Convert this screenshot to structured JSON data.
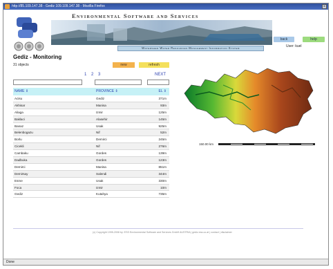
{
  "window": {
    "title": "http://85.109.147.38 - Gediz 109.109.147.38 - Mozilla Firefox"
  },
  "header": {
    "title": "Environmental Software and Services",
    "subtitle": "Watershed Water Resources Management Information System",
    "back_label": "back",
    "help_label": "help",
    "user": "User: kuel"
  },
  "page": {
    "title": "Gediz - Monitoring",
    "count": "31 objects",
    "new_label": "new",
    "refresh_label": "refresh",
    "pages": [
      "1",
      "2",
      "3"
    ],
    "next_label": "NEXT"
  },
  "table": {
    "headers": {
      "name": "NAME ⇕",
      "province": "PROVINCE ⇕",
      "el": "EL ⇕"
    },
    "rows": [
      {
        "name": "Acisu",
        "province": "Gediz",
        "el": "371m"
      },
      {
        "name": "Akhisar",
        "province": "Manisa",
        "el": "93m"
      },
      {
        "name": "Aliaga",
        "province": "Izmir",
        "el": "125m"
      },
      {
        "name": "Baklaci",
        "province": "Alasehir",
        "el": "145m"
      },
      {
        "name": "Banaz",
        "province": "Usak",
        "el": "925m"
      },
      {
        "name": "Belenbogazu",
        "province": "Nif",
        "el": "52m"
      },
      {
        "name": "Borlu",
        "province": "Demirci",
        "el": "245m"
      },
      {
        "name": "Cicekli",
        "province": "Nif",
        "el": "276m"
      },
      {
        "name": "Cambaku",
        "province": "Gordes",
        "el": "139m"
      },
      {
        "name": "Dadbuka",
        "province": "Gordes",
        "el": "123m"
      },
      {
        "name": "Demirci",
        "province": "Manisa",
        "el": "851m"
      },
      {
        "name": "Demirsay",
        "province": "Salendi",
        "el": "344m"
      },
      {
        "name": "Esme",
        "province": "Usak",
        "el": "330m"
      },
      {
        "name": "Foca",
        "province": "Izmir",
        "el": "10m"
      },
      {
        "name": "Gediz",
        "province": "Kutahya",
        "el": "735m"
      }
    ]
  },
  "map": {
    "scale_label": "150.00 km"
  },
  "footer": {
    "text": "(c) Copyright 1995-2008 by:  ESS  Environmental Software and Services GmbH AUSTRIA  |  gediz.ess.co.at  |  contact  |  disclaimer"
  },
  "status": {
    "text": "Done"
  },
  "colors": {
    "header_row": "#c6f1f6",
    "new_button": "#f3b24d",
    "refresh_button": "#f4e05c",
    "back_button": "#a9c9e8",
    "help_button": "#9ddb7e"
  }
}
